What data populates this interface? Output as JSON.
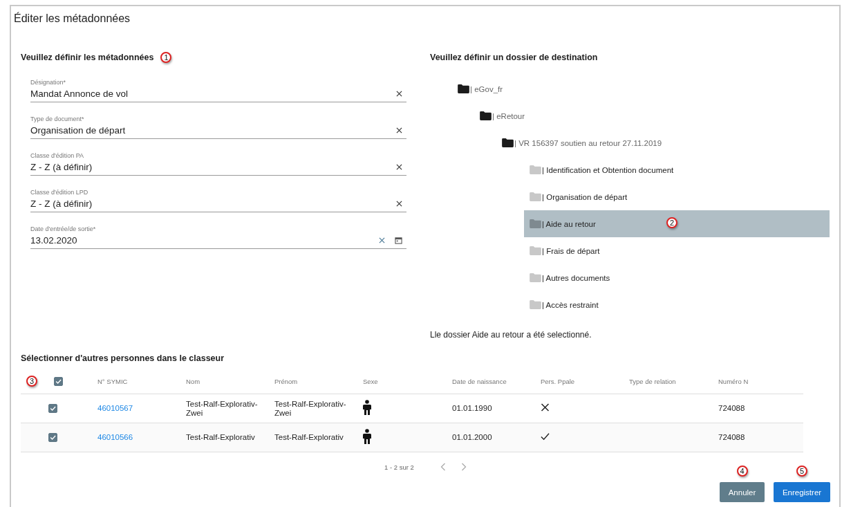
{
  "dialog": {
    "title": "Éditer les métadonnées"
  },
  "metadata": {
    "heading": "Veuillez définir les métadonnées",
    "callout": "1",
    "fields": [
      {
        "label": "Désignation*",
        "value": "Mandat Annonce de vol",
        "kind": "text"
      },
      {
        "label": "Type de document*",
        "value": "Organisation de départ",
        "kind": "text"
      },
      {
        "label": "Classe d'édition PA",
        "value": "Z - Z (à définir)",
        "kind": "text"
      },
      {
        "label": "Classe d'édition LPD",
        "value": "Z - Z (à définir)",
        "kind": "text"
      },
      {
        "label": "Date d'entrée/de sortie*",
        "value": "13.02.2020",
        "kind": "date"
      }
    ]
  },
  "destination": {
    "heading": "Veuillez définir un dossier de destination",
    "callout": "2",
    "tree": [
      {
        "label": "| eGov_fr",
        "selected": false,
        "children": [
          {
            "label": "| eRetour",
            "selected": false,
            "children": [
              {
                "label": "| VR 156397 soutien au retour 27.11.2019",
                "selected": false,
                "children": [
                  {
                    "label": "| Identification et Obtention document",
                    "selected": false
                  },
                  {
                    "label": "| Organisation de départ",
                    "selected": false
                  },
                  {
                    "label": "| Aide au retour",
                    "selected": true
                  },
                  {
                    "label": "| Frais de départ",
                    "selected": false
                  },
                  {
                    "label": "| Autres documents",
                    "selected": false
                  },
                  {
                    "label": "| Accès restraint",
                    "selected": false
                  }
                ]
              }
            ]
          }
        ]
      }
    ],
    "message": "Lle dossier Aide au retour a été selectionné."
  },
  "persons": {
    "heading": "Sélectionner d'autres personnes dans le classeur",
    "callout": "3",
    "all_checked": true,
    "columns": [
      "N° SYMIC",
      "Nom",
      "Prénom",
      "Sexe",
      "Date de naissance",
      "Pers. Ppale",
      "Type de relation",
      "Numéro N"
    ],
    "rows": [
      {
        "checked": true,
        "symic": "46010567",
        "nom": "Test-Ralf-Explorativ-Zwei",
        "prenom": "Test-Ralf-Explorativ-Zwei",
        "date": "01.01.1990",
        "principal": false,
        "numero": "724088"
      },
      {
        "checked": true,
        "symic": "46010566",
        "nom": "Test-Ralf-Explorativ",
        "prenom": "Test-Ralf-Explorativ",
        "date": "01.01.2000",
        "principal": true,
        "numero": "724088"
      }
    ],
    "pagination": "1 - 2 sur 2"
  },
  "buttons": [
    {
      "label": "Annuler",
      "kind": "secondary",
      "callout": "4"
    },
    {
      "label": "Enregistrer",
      "kind": "primary",
      "callout": "5"
    }
  ]
}
